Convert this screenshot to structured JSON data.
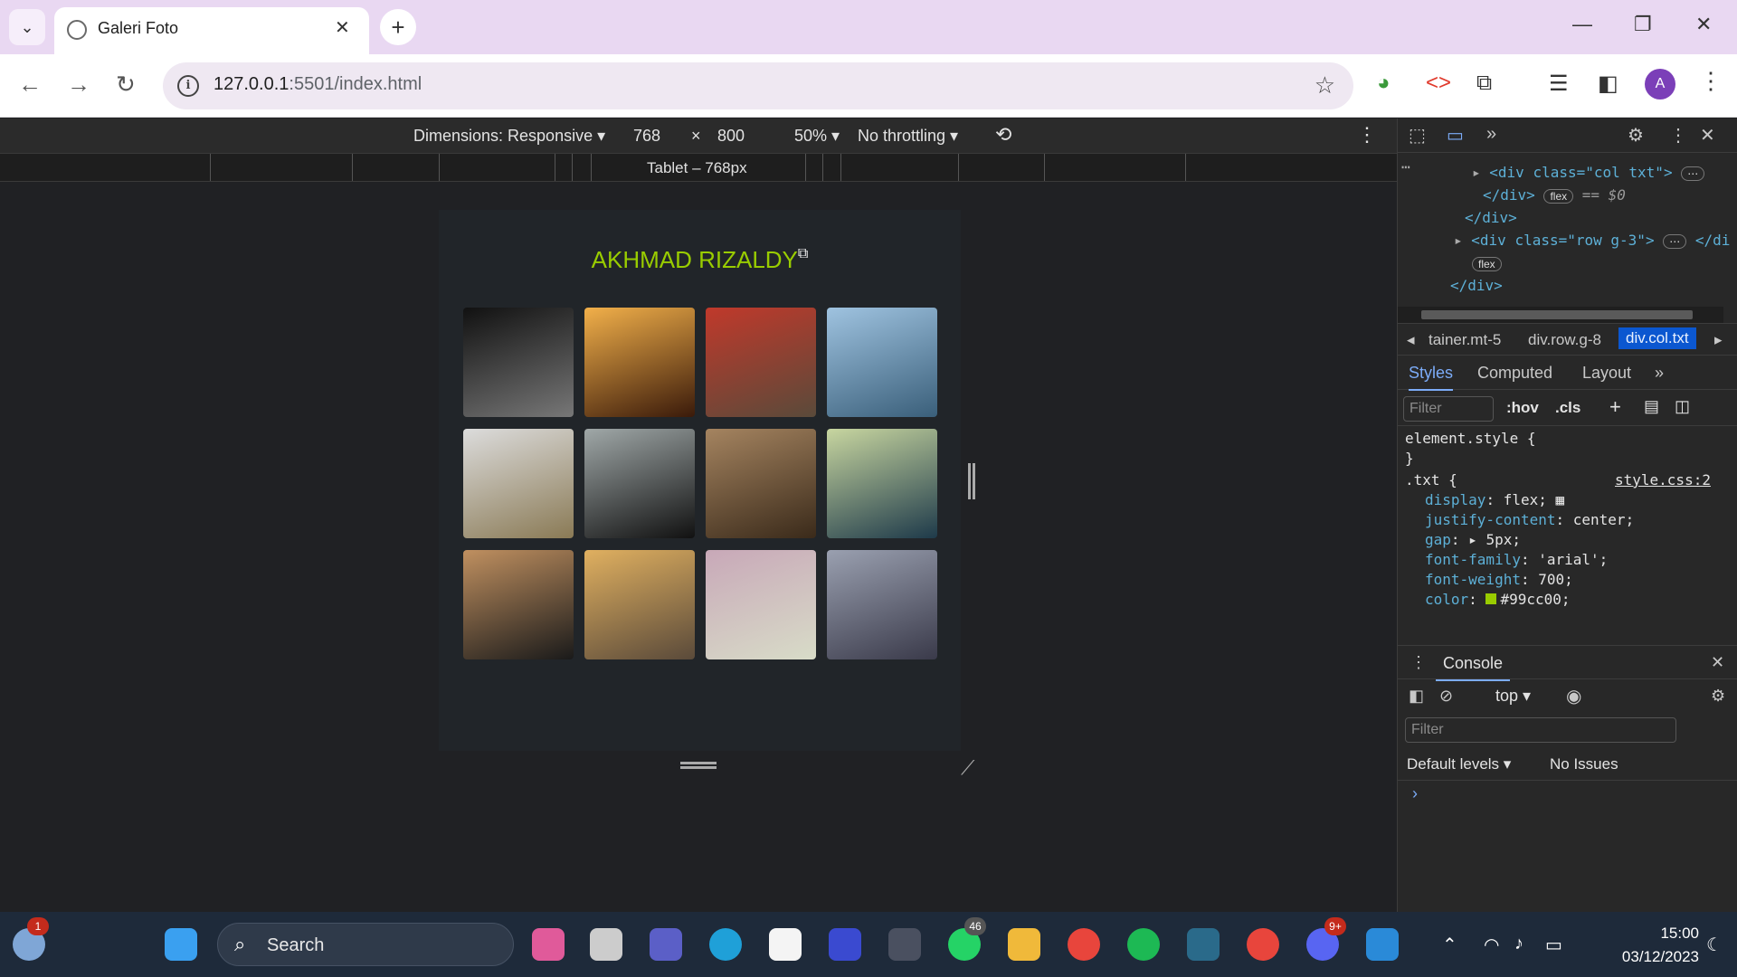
{
  "browser": {
    "tab_title": "Galeri Foto",
    "tab_close": "✕",
    "new_tab": "+",
    "url_host": "127.0.0.1",
    "url_rest": ":5501/index.html",
    "avatar_letter": "A"
  },
  "device_toolbar": {
    "dimensions_label": "Dimensions: Responsive ▾",
    "width": "768",
    "times": "×",
    "height": "800",
    "zoom": "50% ▾",
    "throttling": "No throttling ▾",
    "media_query_label": "Tablet – 768px"
  },
  "page": {
    "title": "AKHMAD RIZALDY",
    "title_color": "#99cc00",
    "photos": [
      {
        "name": "photo-building",
        "colors": [
          "#111111",
          "#777777"
        ]
      },
      {
        "name": "photo-sunset-train",
        "colors": [
          "#f2b04a",
          "#3a1a0a"
        ]
      },
      {
        "name": "photo-red-mailbox",
        "colors": [
          "#c0392b",
          "#5a4a3a"
        ]
      },
      {
        "name": "photo-lake-person",
        "colors": [
          "#9fc3e0",
          "#3a5f7a"
        ]
      },
      {
        "name": "photo-misty-forest",
        "colors": [
          "#dcdcdc",
          "#8a7a55"
        ]
      },
      {
        "name": "photo-tall-trees",
        "colors": [
          "#a0a8a8",
          "#111111"
        ]
      },
      {
        "name": "photo-bear",
        "colors": [
          "#a58460",
          "#3a2a1a"
        ]
      },
      {
        "name": "photo-forest-road",
        "colors": [
          "#c8d6a0",
          "#1e3a4a"
        ]
      },
      {
        "name": "photo-laptop",
        "colors": [
          "#c09060",
          "#1a1a1a"
        ]
      },
      {
        "name": "photo-station-crowd",
        "colors": [
          "#e0b060",
          "#5a4a3a"
        ]
      },
      {
        "name": "photo-pink-trees",
        "colors": [
          "#c8a8b8",
          "#d8dcc8"
        ]
      },
      {
        "name": "photo-foggy-sea",
        "colors": [
          "#9aa0b0",
          "#3a3a4a"
        ]
      }
    ]
  },
  "devtools": {
    "elements": {
      "line1_open": "<div class=\"col txt\">",
      "line2_close": "</div>",
      "flex_badge": "flex",
      "dollar_zero": "== $0",
      "line3": "</div>",
      "line4": "<div class=\"row g-3\">",
      "line4_end": "</di",
      "line6": "</div>"
    },
    "breadcrumbs": [
      "tainer.mt-5",
      "div.row.g-8",
      "div.col.txt"
    ],
    "style_tabs": [
      "Styles",
      "Computed",
      "Layout"
    ],
    "style_filter_placeholder": "Filter",
    "hov": ":hov",
    "cls": ".cls",
    "rules": {
      "element_style": "element.style {",
      "close_brace": "}",
      "selector": ".txt {",
      "source": "style.css:2",
      "props": [
        {
          "name": "display",
          "value": "flex;"
        },
        {
          "name": "justify-content",
          "value": "center;"
        },
        {
          "name": "gap",
          "value": "▸ 5px;"
        },
        {
          "name": "font-family",
          "value": "'arial';"
        },
        {
          "name": "font-weight",
          "value": "700;"
        },
        {
          "name": "color",
          "value": "#99cc00;"
        }
      ]
    },
    "console": {
      "tab": "Console",
      "context": "top",
      "filter_placeholder": "Filter",
      "levels": "Default levels ▾",
      "issues": "No Issues",
      "prompt": "›"
    }
  },
  "taskbar": {
    "search_label": "Search",
    "weather_badge": "1",
    "whatsapp_badge": "46",
    "discord_badge": "9+",
    "time": "15:00",
    "date": "03/12/2023"
  }
}
